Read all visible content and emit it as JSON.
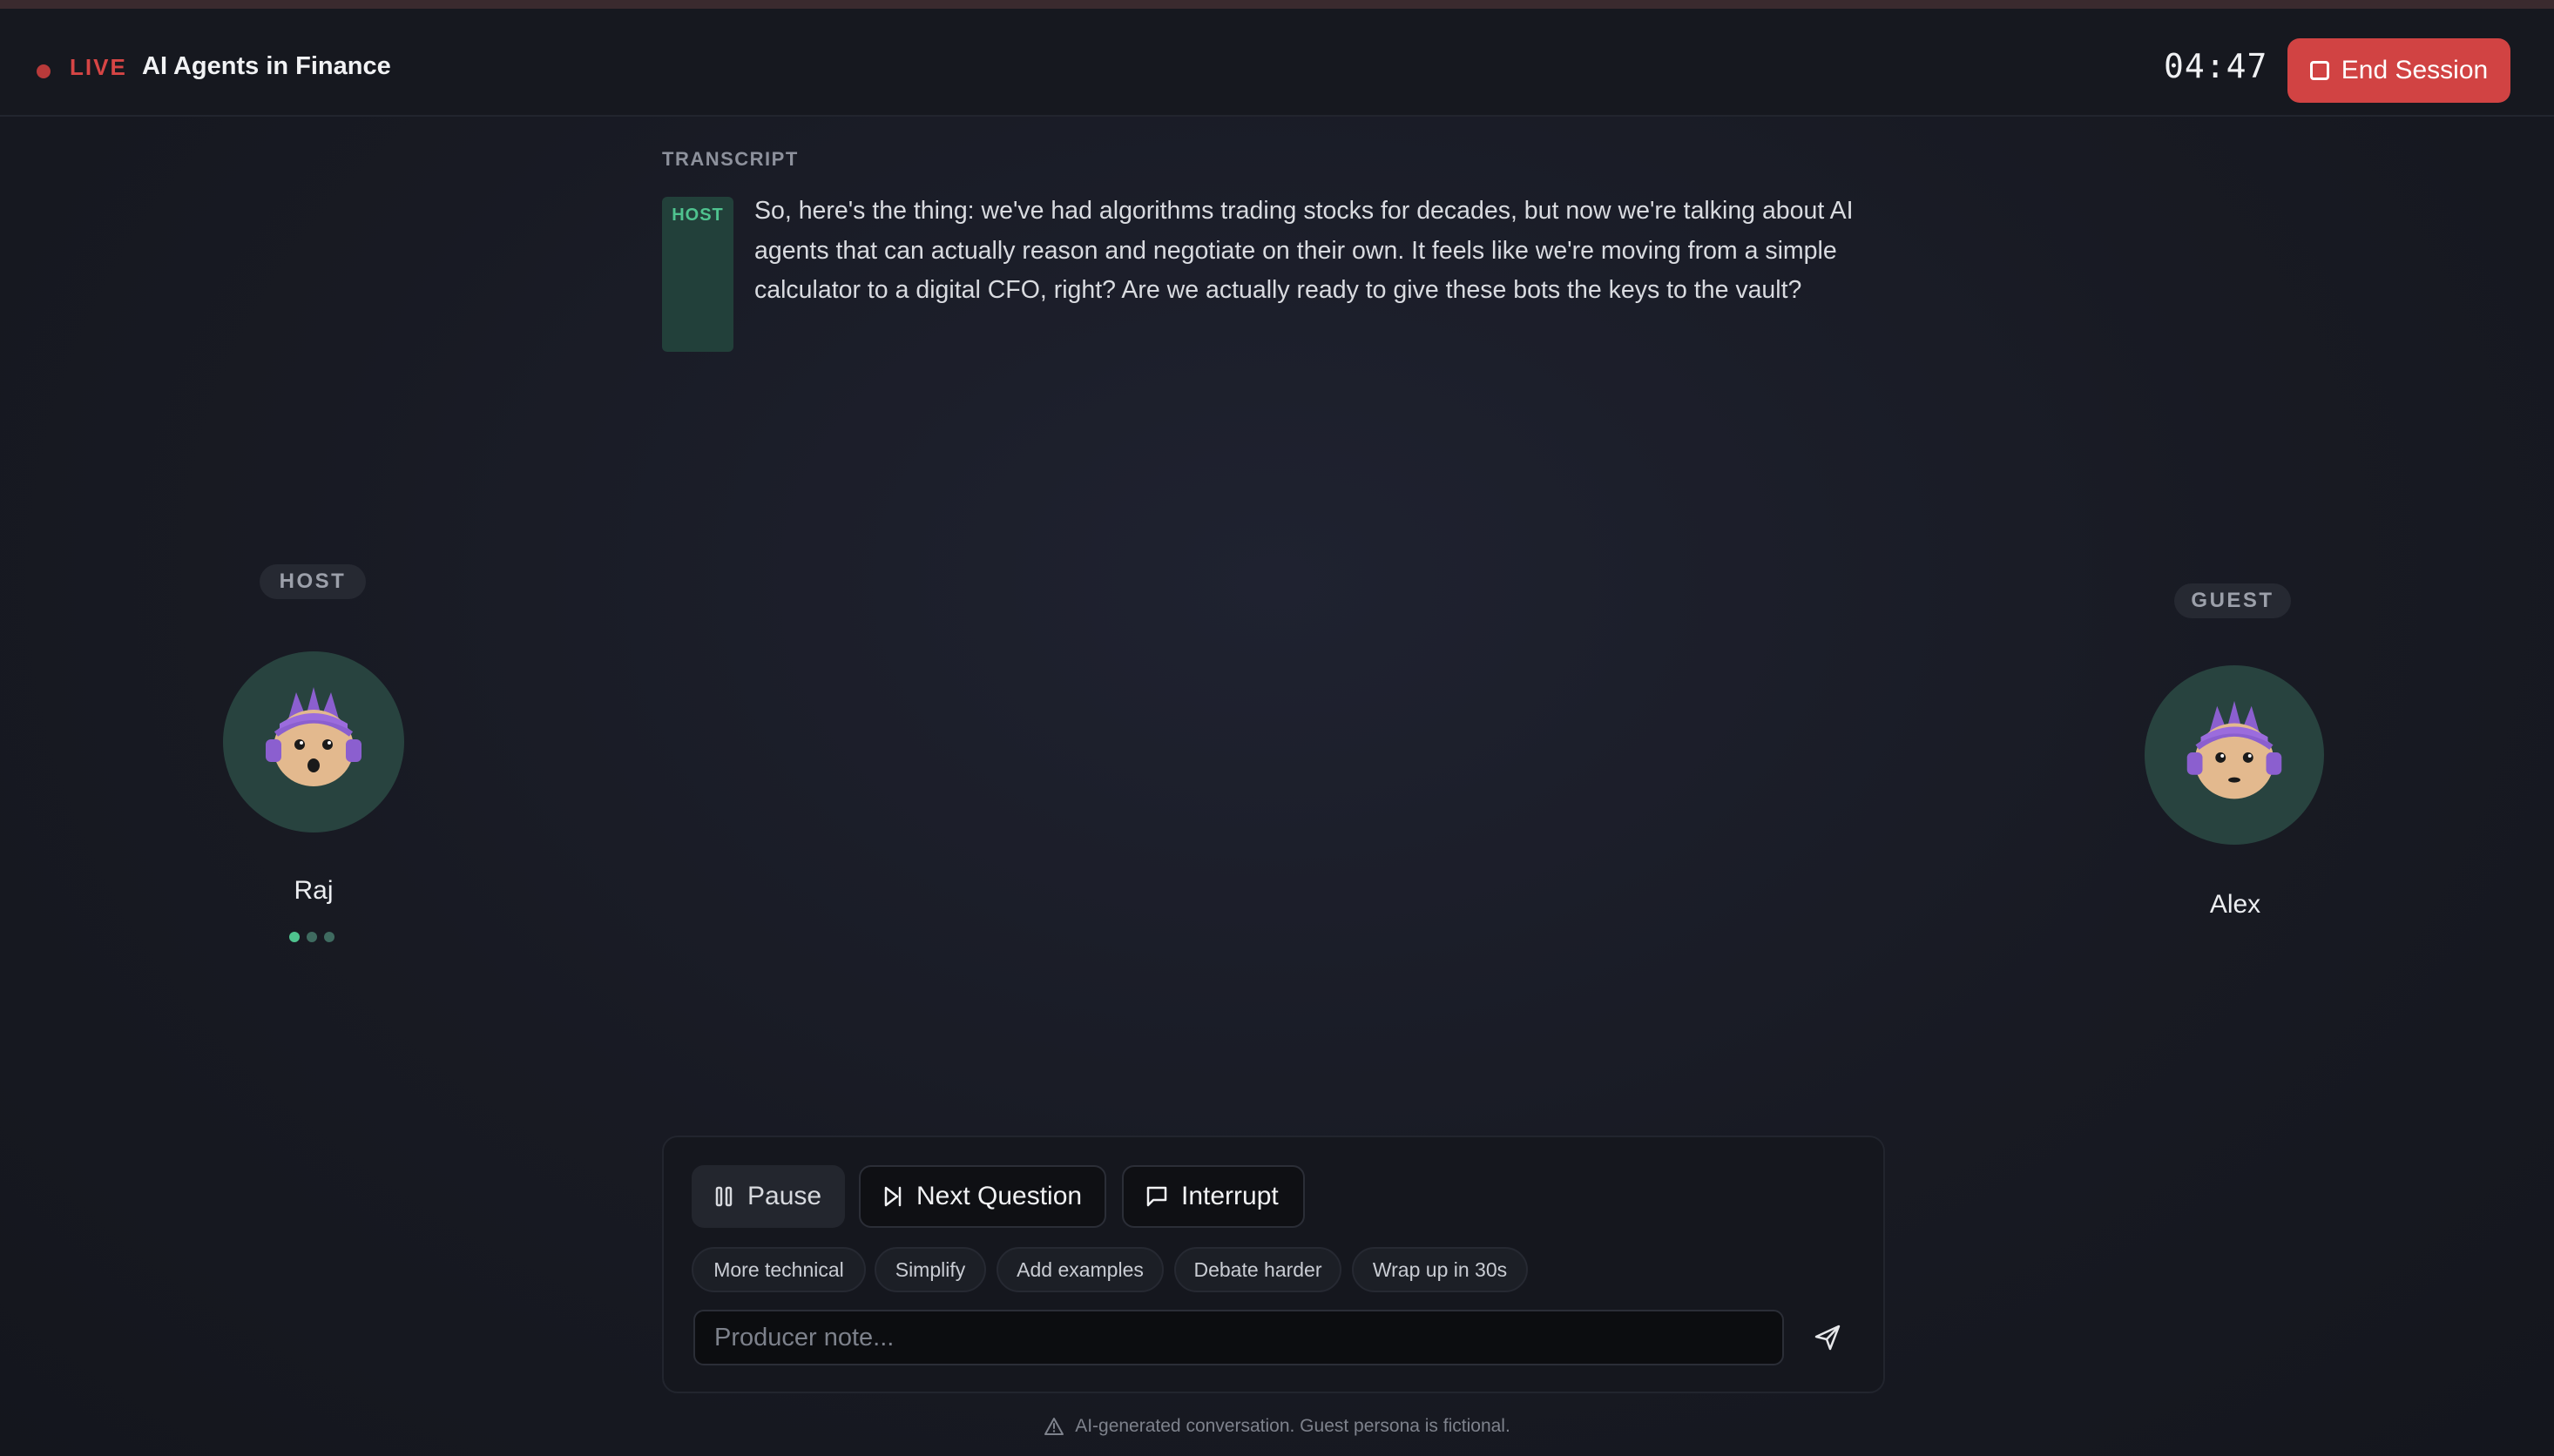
{
  "header": {
    "live_label": "LIVE",
    "session_title": "AI Agents in Finance",
    "timer": "04:47",
    "end_session_label": "End Session",
    "colors": {
      "live": "#d64545",
      "end_button": "#d14343"
    }
  },
  "transcript": {
    "label": "TRANSCRIPT",
    "entries": [
      {
        "speaker_tag": "HOST",
        "text": "So, here's the thing: we've had algorithms trading stocks for decades, but now we're talking about AI agents that can actually reason and negotiate on their own. It feels like we're moving from a simple calculator to a digital CFO, right? Are we actually ready to give these bots the keys to the vault?"
      }
    ]
  },
  "participants": {
    "host": {
      "role": "HOST",
      "name": "Raj",
      "speaking": true
    },
    "guest": {
      "role": "GUEST",
      "name": "Alex",
      "speaking": false
    }
  },
  "controls": {
    "pause_label": "Pause",
    "next_question_label": "Next Question",
    "interrupt_label": "Interrupt",
    "chips": [
      "More technical",
      "Simplify",
      "Add examples",
      "Debate harder",
      "Wrap up in 30s"
    ],
    "producer_note_placeholder": "Producer note..."
  },
  "footer": {
    "disclaimer": "AI-generated conversation. Guest persona is fictional."
  },
  "icons": {
    "pause": "pause-icon",
    "next": "skip-forward-icon",
    "interrupt": "message-square-icon",
    "send": "send-icon",
    "warning": "warning-triangle-icon",
    "end": "stop-square-icon"
  }
}
